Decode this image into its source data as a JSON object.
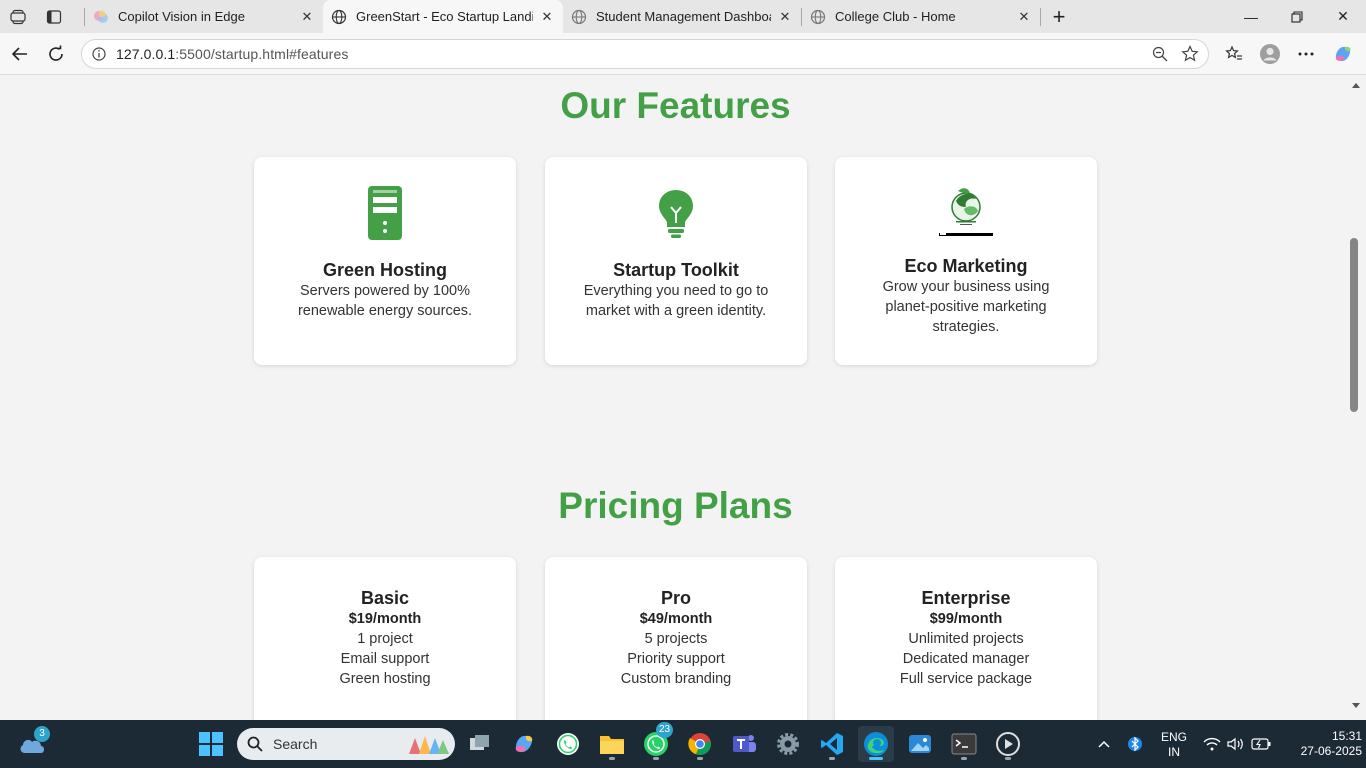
{
  "browser": {
    "tabs": [
      {
        "label": "Copilot Vision in Edge",
        "icon": "copilot-icon",
        "active": false
      },
      {
        "label": "GreenStart - Eco Startup Landing",
        "icon": "globe-icon",
        "active": true
      },
      {
        "label": "Student Management Dashboard",
        "icon": "globe-icon",
        "active": false
      },
      {
        "label": "College Club - Home",
        "icon": "globe-icon",
        "active": false
      }
    ],
    "url_host": "127.0.0.1",
    "url_rest": ":5500/startup.html#features"
  },
  "features": {
    "title": "Our Features",
    "cards": [
      {
        "title": "Green Hosting",
        "text": "Servers powered by 100% renewable energy sources.",
        "icon": "server-icon"
      },
      {
        "title": "Startup Toolkit",
        "text": "Everything you need to go to market with a green identity.",
        "icon": "lightbulb-icon"
      },
      {
        "title": "Eco Marketing",
        "text": "Grow your business using planet-positive marketing strategies.",
        "icon": "eco-globe-image"
      }
    ]
  },
  "pricing": {
    "title": "Pricing Plans",
    "plans": [
      {
        "name": "Basic",
        "price": "$19/month",
        "features": [
          "1 project",
          "Email support",
          "Green hosting"
        ]
      },
      {
        "name": "Pro",
        "price": "$49/month",
        "features": [
          "5 projects",
          "Priority support",
          "Custom branding"
        ]
      },
      {
        "name": "Enterprise",
        "price": "$99/month",
        "features": [
          "Unlimited projects",
          "Dedicated manager",
          "Full service package"
        ]
      }
    ]
  },
  "taskbar": {
    "weather_badge": "3",
    "search_label": "Search",
    "whatsapp_badge": "23",
    "lang_top": "ENG",
    "lang_bottom": "IN",
    "time": "15:31",
    "date": "27-06-2025"
  },
  "colors": {
    "accent_green": "#43a047",
    "taskbar_bg": "#1c2a36"
  }
}
